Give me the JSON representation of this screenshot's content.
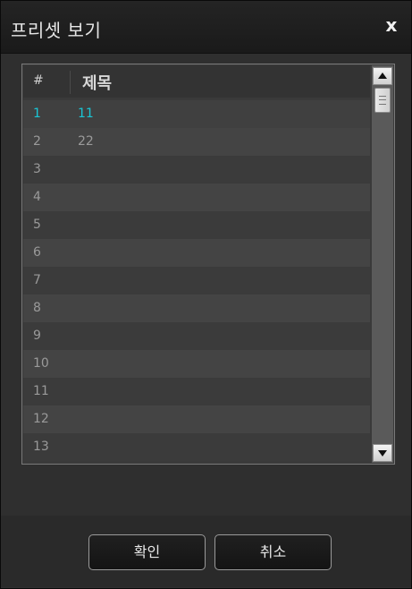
{
  "dialog": {
    "title": "프리셋 보기",
    "close_label": "x"
  },
  "list": {
    "headers": {
      "num": "#",
      "title": "제목"
    },
    "rows": [
      {
        "num": "1",
        "name": "11",
        "selected": true
      },
      {
        "num": "2",
        "name": "22"
      },
      {
        "num": "3",
        "name": ""
      },
      {
        "num": "4",
        "name": ""
      },
      {
        "num": "5",
        "name": ""
      },
      {
        "num": "6",
        "name": ""
      },
      {
        "num": "7",
        "name": ""
      },
      {
        "num": "8",
        "name": ""
      },
      {
        "num": "9",
        "name": ""
      },
      {
        "num": "10",
        "name": ""
      },
      {
        "num": "11",
        "name": ""
      },
      {
        "num": "12",
        "name": ""
      },
      {
        "num": "13",
        "name": ""
      }
    ]
  },
  "buttons": {
    "ok": "확인",
    "cancel": "취소"
  },
  "colors": {
    "selected_text": "#19c6d6",
    "row_text": "#9a9a9a"
  },
  "icons": {
    "scroll_up": "triangle-up-icon",
    "scroll_down": "triangle-down-icon",
    "scroll_thumb": "grip-lines-icon"
  }
}
